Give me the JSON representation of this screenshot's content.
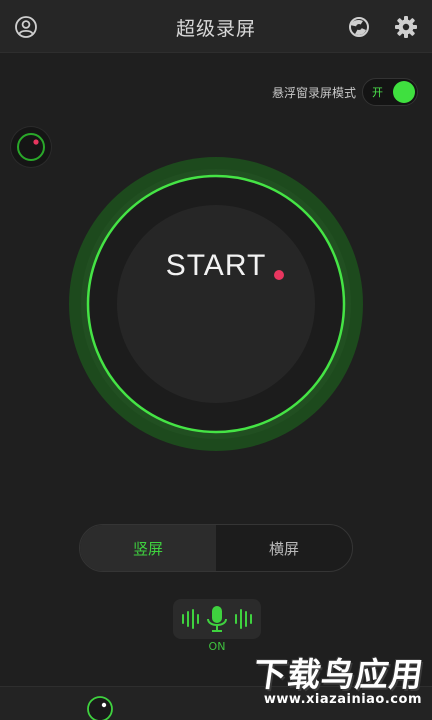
{
  "header": {
    "title": "超级录屏",
    "icons": [
      "user-icon",
      "theme-icon",
      "gear-icon"
    ]
  },
  "floating_mode": {
    "label": "悬浮窗录屏模式",
    "state_text": "开",
    "enabled": true
  },
  "record": {
    "start_label": "START"
  },
  "orientation": {
    "tabs": [
      {
        "label": "竖屏",
        "selected": true
      },
      {
        "label": "横屏",
        "selected": false
      }
    ]
  },
  "mic": {
    "icon": "microphone-icon",
    "state": "ON"
  },
  "watermark": {
    "brand": "下载鸟应用",
    "url": "www.xiazainiao.com"
  },
  "colors": {
    "accent": "#3fd23f",
    "background": "#1f1f1f",
    "record_dot": "#e8365f"
  }
}
